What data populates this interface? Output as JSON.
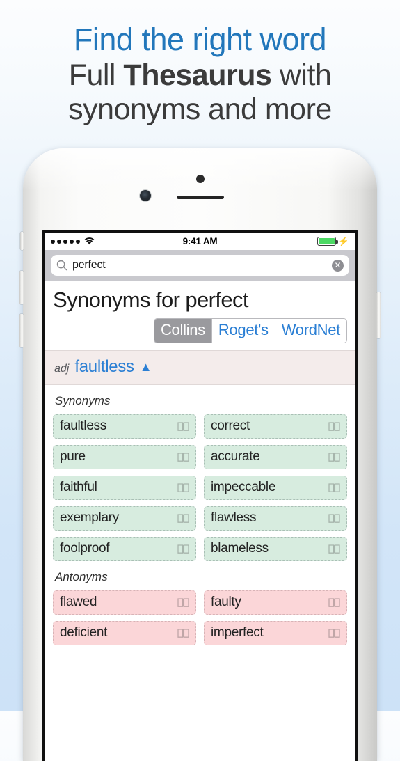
{
  "promo": {
    "line1": "Find the right word",
    "line2_pre": "Full ",
    "line2_bold": "Thesaurus",
    "line2_post": " with",
    "line3": "synonyms and more",
    "accent_color": "#2277bb",
    "text_color": "#3b3b3b"
  },
  "status_bar": {
    "signal_dots": 5,
    "wifi_icon": "wifi-icon",
    "time": "9:41 AM",
    "battery_icon": "battery-full-icon",
    "battery_color": "#4cd964",
    "charging_icon": "lightning-bolt-icon"
  },
  "search": {
    "icon": "search-icon",
    "value": "perfect",
    "placeholder": "Search",
    "clear_icon": "clear-circle-icon",
    "clear_glyph": "✕"
  },
  "page": {
    "title": "Synonyms for perfect"
  },
  "segmented_control": {
    "options": [
      {
        "label": "Collins",
        "selected": true
      },
      {
        "label": "Roget's",
        "selected": false
      },
      {
        "label": "WordNet",
        "selected": false
      }
    ],
    "selected_bg": "#9a9a9e",
    "link_color": "#2b7fd4"
  },
  "sense": {
    "pos": "adj",
    "word": "faultless",
    "expander_glyph": "▲",
    "header_bg": "#f4eceb"
  },
  "sections": [
    {
      "label": "Synonyms",
      "chip_bg": "#d7ecdf",
      "chip_border": "#a9bfb5",
      "chips": [
        {
          "label": "faultless",
          "icon": "book-icon"
        },
        {
          "label": "correct",
          "icon": "book-icon"
        },
        {
          "label": "pure",
          "icon": "book-icon"
        },
        {
          "label": "accurate",
          "icon": "book-icon"
        },
        {
          "label": "faithful",
          "icon": "book-icon"
        },
        {
          "label": "impeccable",
          "icon": "book-icon"
        },
        {
          "label": "exemplary",
          "icon": "book-icon"
        },
        {
          "label": "flawless",
          "icon": "book-icon"
        },
        {
          "label": "foolproof",
          "icon": "book-icon"
        },
        {
          "label": "blameless",
          "icon": "book-icon"
        }
      ]
    },
    {
      "label": "Antonyms",
      "chip_bg": "#fbd6d8",
      "chip_border": "#d7b3b6",
      "chips": [
        {
          "label": "flawed",
          "icon": "book-icon"
        },
        {
          "label": "faulty",
          "icon": "book-icon"
        },
        {
          "label": "deficient",
          "icon": "book-icon"
        },
        {
          "label": "imperfect",
          "icon": "book-icon"
        }
      ]
    }
  ],
  "device": {
    "sensor_icon": "proximity-sensor",
    "camera_icon": "front-camera",
    "speaker_icon": "earpiece-speaker",
    "buttons": [
      "silent-switch",
      "volume-up",
      "volume-down",
      "power"
    ]
  }
}
